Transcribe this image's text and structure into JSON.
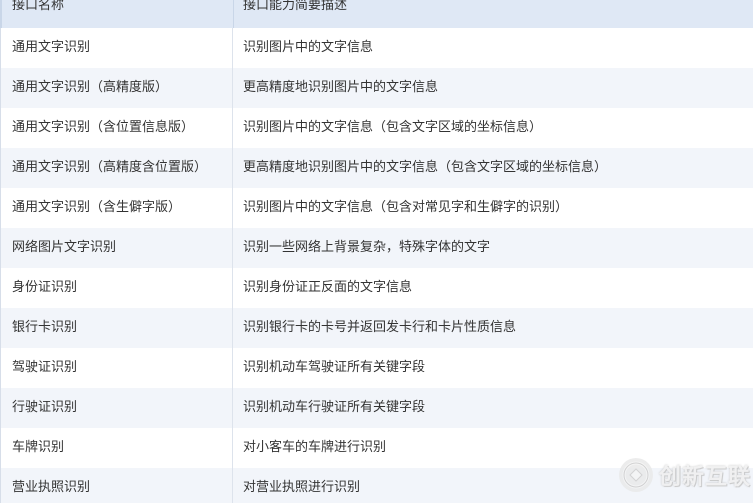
{
  "table": {
    "headers": [
      "接口名称",
      "接口能力简要描述"
    ],
    "rows": [
      [
        "通用文字识别",
        "识别图片中的文字信息"
      ],
      [
        "通用文字识别（高精度版）",
        "更高精度地识别图片中的文字信息"
      ],
      [
        "通用文字识别（含位置信息版）",
        "识别图片中的文字信息（包含文字区域的坐标信息）"
      ],
      [
        "通用文字识别（高精度含位置版）",
        "更高精度地识别图片中的文字信息（包含文字区域的坐标信息）"
      ],
      [
        "通用文字识别（含生僻字版）",
        "识别图片中的文字信息（包含对常见字和生僻字的识别）"
      ],
      [
        "网络图片文字识别",
        "识别一些网络上背景复杂，特殊字体的文字"
      ],
      [
        "身份证识别",
        "识别身份证正反面的文字信息"
      ],
      [
        "银行卡识别",
        "识别银行卡的卡号并返回发卡行和卡片性质信息"
      ],
      [
        "驾驶证识别",
        "识别机动车驾驶证所有关键字段"
      ],
      [
        "行驶证识别",
        "识别机动车行驶证所有关键字段"
      ],
      [
        "车牌识别",
        "对小客车的车牌进行识别"
      ],
      [
        "营业执照识别",
        "对营业执照进行识别"
      ]
    ]
  },
  "watermark": {
    "text": "创新互联",
    "icon": "brand-logo-icon"
  },
  "colors": {
    "header_bg": "#dfe8f5",
    "row_alt_bg": "#f2f5fa",
    "text": "#333333"
  }
}
